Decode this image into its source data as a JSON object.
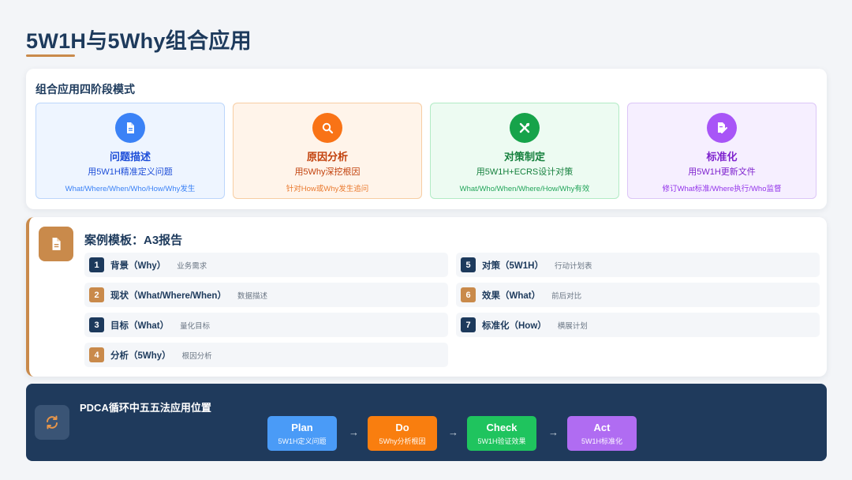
{
  "title": "5W1H与5Why组合应用",
  "stages": {
    "heading": "组合应用四阶段模式",
    "items": [
      {
        "name": "问题描述",
        "desc": "用5W1H精准定义问题",
        "sub": "What/Where/When/Who/How/Why发生",
        "icon": "document-icon"
      },
      {
        "name": "原因分析",
        "desc": "用5Why深挖根因",
        "sub": "针对How或Why发生追问",
        "icon": "search-icon"
      },
      {
        "name": "对策制定",
        "desc": "用5W1H+ECRS设计对策",
        "sub": "What/Who/When/Where/How/Why有效",
        "icon": "tools-icon"
      },
      {
        "name": "标准化",
        "desc": "用5W1H更新文件",
        "sub": "修订What标准/Where执行/Who监督",
        "icon": "edit-document-icon"
      }
    ],
    "colors": {
      "blue": "#3b82f6",
      "orange": "#f97316",
      "green": "#16a34a",
      "purple": "#a855f7"
    }
  },
  "case": {
    "title": "案例模板：A3报告",
    "rows": [
      {
        "num": "1",
        "label": "背景（Why）",
        "note": "业务需求"
      },
      {
        "num": "2",
        "label": "现状（What/Where/When）",
        "note": "数据描述"
      },
      {
        "num": "3",
        "label": "目标（What）",
        "note": "量化目标"
      },
      {
        "num": "4",
        "label": "分析（5Why）",
        "note": "根因分析"
      },
      {
        "num": "5",
        "label": "对策（5W1H）",
        "note": "行动计划表"
      },
      {
        "num": "6",
        "label": "效果（What）",
        "note": "前后对比"
      },
      {
        "num": "7",
        "label": "标准化（How）",
        "note": "横展计划"
      }
    ]
  },
  "pdca": {
    "title": "PDCA循环中五五法应用位置",
    "arrow": "→",
    "steps": [
      {
        "name": "Plan",
        "desc": "5W1H定义问题",
        "color": "#4a9bf7"
      },
      {
        "name": "Do",
        "desc": "5Why分析根因",
        "color": "#f97e0f"
      },
      {
        "name": "Check",
        "desc": "5W1H验证效果",
        "color": "#1fc45e"
      },
      {
        "name": "Act",
        "desc": "5W1H标准化",
        "color": "#b06cf2"
      }
    ]
  }
}
